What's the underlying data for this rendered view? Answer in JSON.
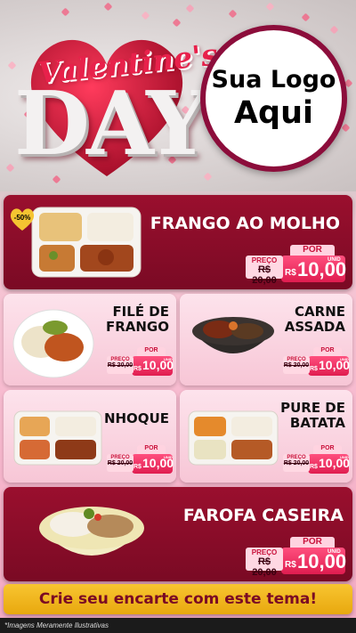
{
  "header": {
    "title_top": "Valentine's",
    "title_bottom": "DAY",
    "logo_line1": "Sua Logo",
    "logo_line2": "Aqui"
  },
  "featured_1": {
    "badge": "-50%",
    "name": "FRANGO AO MOLHO",
    "price": {
      "por_label": "POR",
      "old_label": "PREÇO",
      "old_value": "R$ 20,00",
      "currency": "R$",
      "value": "10,00",
      "unit": "UNID"
    }
  },
  "items": [
    {
      "name_line1": "FILÉ DE",
      "name_line2": "FRANGO",
      "price": {
        "por_label": "POR",
        "old_label": "PREÇO",
        "old_value": "R$ 20,00",
        "currency": "R$",
        "value": "10,00",
        "unit": "UNID"
      }
    },
    {
      "name_line1": "CARNE",
      "name_line2": "ASSADA",
      "price": {
        "por_label": "POR",
        "old_label": "PREÇO",
        "old_value": "R$ 20,00",
        "currency": "R$",
        "value": "10,00",
        "unit": "UNID"
      }
    },
    {
      "name_line1": "NHOQUE",
      "name_line2": "",
      "price": {
        "por_label": "POR",
        "old_label": "PREÇO",
        "old_value": "R$ 20,00",
        "currency": "R$",
        "value": "10,00",
        "unit": "UNID"
      }
    },
    {
      "name_line1": "PURE DE",
      "name_line2": "BATATA",
      "price": {
        "por_label": "POR",
        "old_label": "PREÇO",
        "old_value": "R$ 20,00",
        "currency": "R$",
        "value": "10,00",
        "unit": "UNID"
      }
    }
  ],
  "featured_2": {
    "name": "FAROFA CASEIRA",
    "price": {
      "por_label": "POR",
      "old_label": "PREÇO",
      "old_value": "R$ 20,00",
      "currency": "R$",
      "value": "10,00",
      "unit": "UNID"
    }
  },
  "cta": "Crie seu encarte com este tema!",
  "footer": "*Imagens Meramente Ilustrativas",
  "colors": {
    "dark_card": "#8a0d29",
    "accent_pink": "#ff3d6e",
    "cta_yellow": "#f2b81f",
    "logo_ring": "#8c0d3b"
  }
}
